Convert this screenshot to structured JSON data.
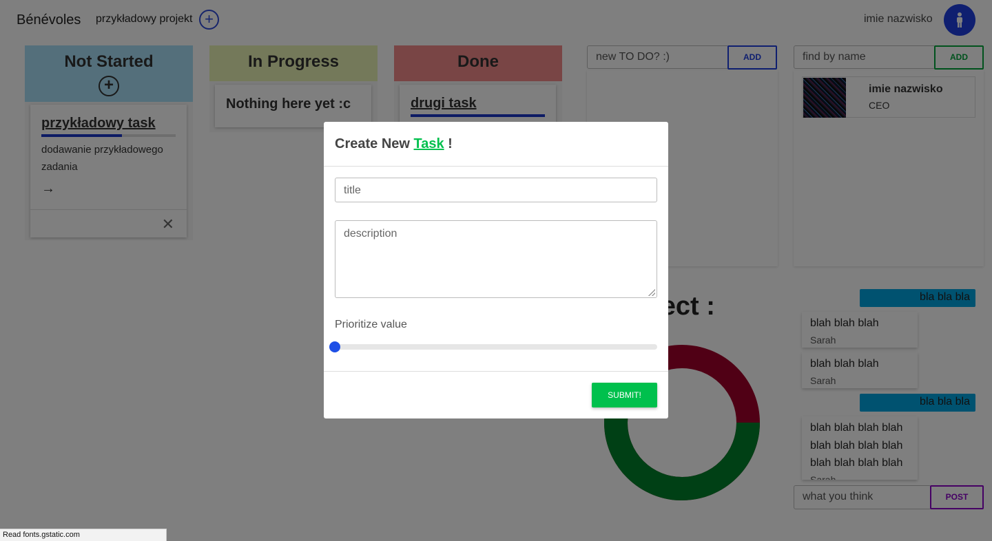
{
  "header": {
    "brand": "Bénévoles",
    "project_name": "przykładowy projekt",
    "add_project_icon": "+",
    "user_name": "imie nazwisko",
    "avatar_icon": "person-icon"
  },
  "columns": {
    "not_started": {
      "title": "Not Started",
      "add_icon": "+",
      "task": {
        "title": "przykładowy task",
        "progress": 0.6,
        "description": "dodawanie przykładowego zadania",
        "arrow": "→",
        "close": "✕"
      }
    },
    "in_progress": {
      "title": "In Progress",
      "empty_text": "Nothing here yet :c"
    },
    "done": {
      "title": "Done",
      "task": {
        "title": "drugi task",
        "progress": 1.0
      }
    }
  },
  "todo": {
    "placeholder": "new TO DO? :)",
    "add_label": "ADD"
  },
  "people": {
    "placeholder": "find by name",
    "add_label": "ADD",
    "members": [
      {
        "name": "imie nazwisko",
        "role": "CEO"
      }
    ]
  },
  "project_heading": "oject :",
  "donut": {
    "completed_fraction": 0.63,
    "colors": {
      "done": "#00802b",
      "remaining": "#a0002a"
    }
  },
  "chat": {
    "tags": [
      "bla bla bla",
      "bla bla bla"
    ],
    "messages": [
      {
        "text": "blah blah blah",
        "author": "Sarah"
      },
      {
        "text": "blah blah blah",
        "author": "Sarah"
      },
      {
        "text": "blah blah blah blah blah blah blah blah blah blah blah blah",
        "author": "Sarah"
      }
    ],
    "placeholder": "what you think",
    "post_label": "POST"
  },
  "modal": {
    "heading_prefix": "Create New ",
    "heading_accent": "Task",
    "heading_suffix": " !",
    "title_placeholder": "title",
    "description_placeholder": "description",
    "priority_label": "Prioritize value",
    "priority_value": 0,
    "submit_label": "SUBMIT!"
  },
  "status_bar": "Read fonts.gstatic.com",
  "colors": {
    "accent_green": "#00c04d",
    "accent_blue": "#1e3fe0",
    "purple": "#8a00c9",
    "not_started": "#a8dff6",
    "in_progress": "#e8f2b4",
    "done": "#f28b8b",
    "chat_tag": "#00a4e0"
  }
}
